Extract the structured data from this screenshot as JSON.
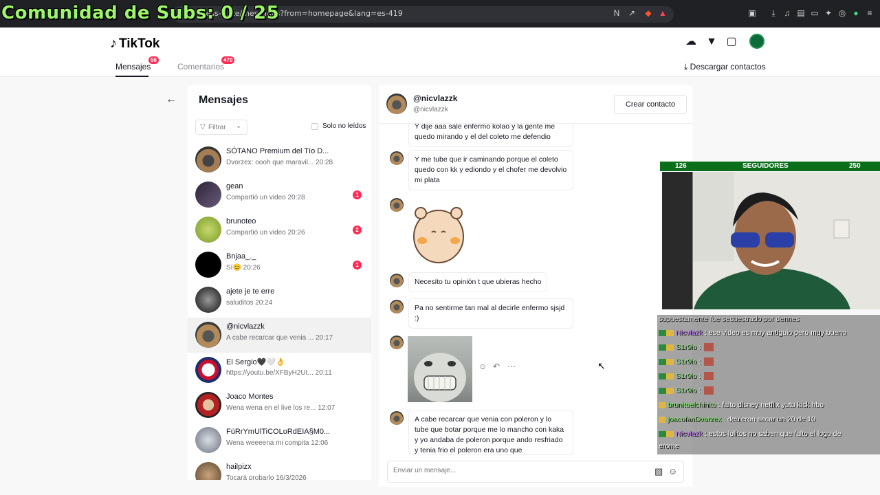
{
  "overlay": {
    "subs_text": "Comunidad de Subs: 0 / 25"
  },
  "browser": {
    "url": "...ness-suite/messages?from=homepage&lang=es-419"
  },
  "header": {
    "logo_text": "TikTok",
    "tabs": [
      {
        "label": "Mensajes",
        "badge": "56"
      },
      {
        "label": "Comentarios",
        "badge": "470"
      }
    ],
    "download_label": "Descargar contactos"
  },
  "list": {
    "title": "Mensajes",
    "filter_label": "Filtrar",
    "unread_only_label": "Solo no leídos",
    "conversations": [
      {
        "name": "SÓTANO Premium del Tío D...",
        "preview": "Dvorzex: oooh que maravil... 20:28",
        "unread": ""
      },
      {
        "name": "gean",
        "preview": "Compartió un video 20:28",
        "unread": "1"
      },
      {
        "name": "brunoteo",
        "preview": "Compartió un video 20:26",
        "unread": "2"
      },
      {
        "name": "Bnjaa_._",
        "preview": "Sí😊 20:26",
        "unread": "1"
      },
      {
        "name": "ajete je te erre",
        "preview": "saluditos 20:24",
        "unread": ""
      },
      {
        "name": "@nicvlazzk",
        "preview": "A cabe recarcar que venia ...  20:17",
        "unread": ""
      },
      {
        "name": "El Sergio🖤🤍👌",
        "preview": "https://youtu.be/XFByH2Ut... 20:11",
        "unread": ""
      },
      {
        "name": "Joaco Montes",
        "preview": "Wena wena en el live los re... 12:07",
        "unread": ""
      },
      {
        "name": "FüRrYmUlTiCOLoRdEIA§M0...",
        "preview": "Wena weeeena mi compita 12:06",
        "unread": ""
      },
      {
        "name": "hailpizx",
        "preview": "Tocará probarlo 16/3/2026",
        "unread": ""
      }
    ]
  },
  "chat": {
    "name": "@nicvlazzk",
    "handle": "@nicvlazzk",
    "create_contact_label": "Crear contacto",
    "messages": [
      "Y dije aaa sale enfermo kolao y la gente me quedo mirando y el del coleto me defendio",
      "Y me tube que ir caminando porque el coleto quedo con kk y ediondo  y el chofer me devolvio mi plata",
      "Necesito tu opinión t que ubieras hecho",
      "Pa no sentirme tan mal al decirle enfermo sjsjd :)",
      "A cabe recarcar que venia con poleron y lo tube que botar porque me lo mancho con kaka  y yo andaba de poleron porque ando resfriado y tenia frio  el poleron era uno que"
    ],
    "composer_placeholder": "Enviar un mensaje..."
  },
  "stream": {
    "followers_current": "126",
    "followers_label": "SEGUIDORES",
    "followers_goal": "250",
    "chat": [
      {
        "user": "",
        "text": "supuestamente fue secuestrado por dennes",
        "user_color": "#ffffff"
      },
      {
        "user": "Nicvlazk",
        "text": " : ese video es muy antiguio pero muy bueno",
        "user_color": "#b06de0"
      },
      {
        "user": "S1r9io",
        "text": " : ",
        "user_color": "#7fe06b"
      },
      {
        "user": "S1r9io",
        "text": " : ",
        "user_color": "#7fe06b"
      },
      {
        "user": "S1r9io",
        "text": " : ",
        "user_color": "#7fe06b"
      },
      {
        "user": "S1r9io",
        "text": " : ",
        "user_color": "#7fe06b"
      },
      {
        "user": "brunitoelchinito",
        "text": " : falto disney netflix yutu kick hbo",
        "user_color": "#7fe06b"
      },
      {
        "user": "joacofanDvorzex",
        "text": " : debieron sacar un 20 de 10",
        "user_color": "#7fe06b"
      },
      {
        "user": "Nicvlazk",
        "text": " : estos lolitos no saben que falto el logo de",
        "user_color": "#b06de0"
      },
      {
        "user": "",
        "text": "erome",
        "user_color": "#ffffff"
      }
    ]
  },
  "colors": {
    "accent": "#fe2c55",
    "follower_bar": "#0b6e1a"
  }
}
